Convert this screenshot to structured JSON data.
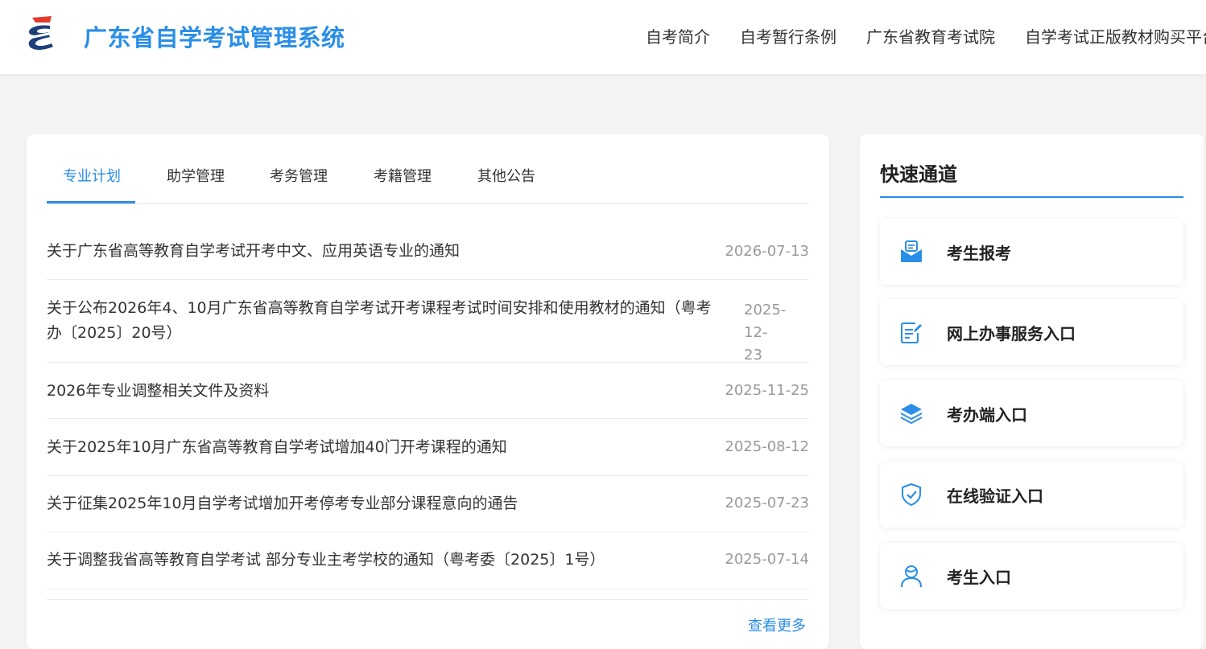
{
  "header": {
    "site_title": "广东省自学考试管理系统",
    "nav": [
      "自考简介",
      "自考暂行条例",
      "广东省教育考试院",
      "自学考试正版教材购买平台"
    ]
  },
  "tabs": {
    "items": [
      "专业计划",
      "助学管理",
      "考务管理",
      "考籍管理",
      "其他公告"
    ],
    "active": "专业计划"
  },
  "news": [
    {
      "title": "关于广东省高等教育自学考试开考中文、应用英语专业的通知",
      "date": "2026-07-13"
    },
    {
      "title_line1": "关于公布2026年4、10月广东省高等教育自学考试开考课程考试时间安排和使用教材的通知（粤考",
      "title_line2": "办〔2025〕20号）",
      "date_line1": "2025-12-",
      "date_line2": "23"
    },
    {
      "title": "2026年专业调整相关文件及资料",
      "date": "2025-11-25"
    },
    {
      "title": "关于2025年10月广东省高等教育自学考试增加40门开考课程的通知",
      "date": "2025-08-12"
    },
    {
      "title": "关于征集2025年10月自学考试增加开考停考专业部分课程意向的通告",
      "date": "2025-07-23"
    },
    {
      "title": "关于调整我省高等教育自学考试 部分专业主考学校的通知（粤考委〔2025〕1号）",
      "date": "2025-07-14"
    }
  ],
  "more_label": "查看更多",
  "sidebar": {
    "title": "快速通道",
    "items": [
      {
        "label": "考生报考",
        "icon": "mail-icon"
      },
      {
        "label": "网上办事服务入口",
        "icon": "document-edit-icon"
      },
      {
        "label": "考办端入口",
        "icon": "layers-icon"
      },
      {
        "label": "在线验证入口",
        "icon": "shield-check-icon"
      },
      {
        "label": "考生入口",
        "icon": "user-icon"
      }
    ]
  },
  "colors": {
    "accent": "#2a8ee8",
    "text": "#333333",
    "muted": "#999999",
    "background": "#f4f4f4"
  }
}
